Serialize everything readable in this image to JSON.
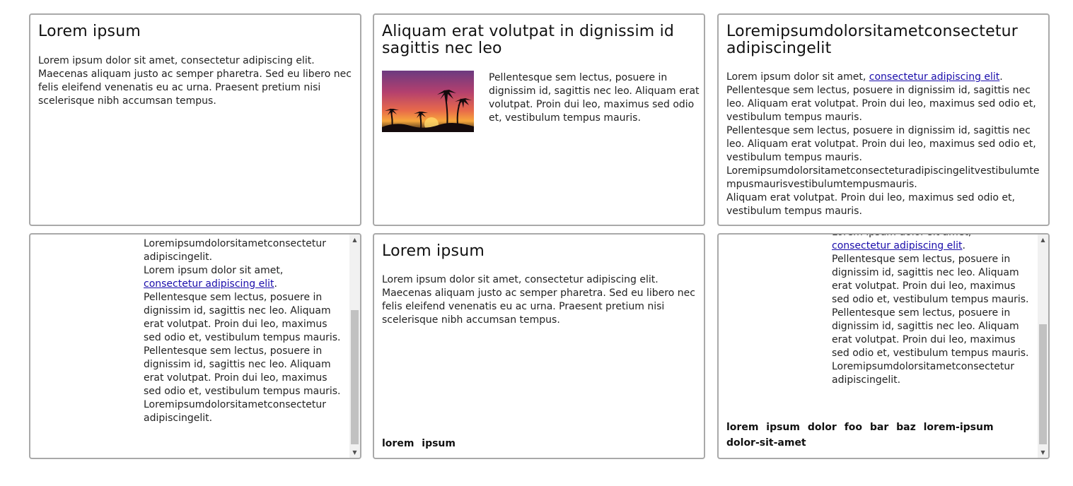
{
  "cards": [
    {
      "title": "Lorem ipsum",
      "body": "Lorem ipsum dolor sit amet, consectetur adipiscing elit. Maecenas aliquam justo ac semper pharetra. Sed eu libero nec felis eleifend venenatis eu ac urna. Praesent pretium nisi scelerisque nibh accumsan tempus."
    },
    {
      "title": "Aliquam erat volutpat in dignissim id sagittis nec leo",
      "image_name": "sunset-palms-image",
      "body": "Pellentesque sem lectus, posuere in dignissim id, sagittis nec leo. Aliquam erat volutpat. Proin dui leo, maximus sed odio et, vestibulum tempus mauris."
    },
    {
      "title": "Loremipsumdolorsitametconsectetur adipiscingelit",
      "body_prefix": "Lorem ipsum dolor sit amet, ",
      "link_text": "consectetur adipiscing elit",
      "body_suffix": ".",
      "paragraphs": [
        "Pellentesque sem lectus, posuere in dignissim id, sagittis nec leo. Aliquam erat volutpat. Proin dui leo, maximus sed odio et, vestibulum tempus mauris.",
        "Pellentesque sem lectus, posuere in dignissim id, sagittis nec leo. Aliquam erat volutpat. Proin dui leo, maximus sed odio et, vestibulum tempus mauris.",
        "Loremipsumdolorsitametconsecteturadipiscingelitvestibulumtempusmaurisvestibulumtempusmauris.",
        "Aliquam erat volutpat. Proin dui leo, maximus sed odio et, vestibulum tempus mauris."
      ]
    },
    {
      "line1": "Loremipsumdolorsitametconsectetur adipiscingelit.",
      "body_prefix": "Lorem ipsum dolor sit amet, ",
      "link_text": "consectetur adipiscing elit",
      "body_suffix": ".",
      "paragraphs": [
        "Pellentesque sem lectus, posuere in dignissim id, sagittis nec leo. Aliquam erat volutpat. Proin dui leo, maximus sed odio et, vestibulum tempus mauris.",
        "Pellentesque sem lectus, posuere in dignissim id, sagittis nec leo. Aliquam erat volutpat. Proin dui leo, maximus sed odio et, vestibulum tempus mauris.",
        "Loremipsumdolorsitametconsectetur adipiscingelit."
      ]
    },
    {
      "title": "Lorem ipsum",
      "body": "Lorem ipsum dolor sit amet, consectetur adipiscing elit. Maecenas aliquam justo ac semper pharetra. Sed eu libero nec felis eleifend venenatis eu ac urna. Praesent pretium nisi scelerisque nibh accumsan tempus.",
      "footer": "lorem ipsum"
    },
    {
      "line0": "Lorem ipsum dolor sit amet,",
      "link_text": "consectetur adipiscing elit",
      "body_suffix": ".",
      "paragraphs": [
        "Pellentesque sem lectus, posuere in dignissim id, sagittis nec leo. Aliquam erat volutpat. Proin dui leo, maximus sed odio et, vestibulum tempus mauris.",
        "Pellentesque sem lectus, posuere in dignissim id, sagittis nec leo. Aliquam erat volutpat. Proin dui leo, maximus sed odio et, vestibulum tempus mauris.",
        "Loremipsumdolorsitametconsectetur adipiscingelit."
      ],
      "footer": "lorem ipsum dolor foo bar baz lorem-ipsum dolor-sit-amet"
    }
  ],
  "scrollbar": {
    "up_icon": "scroll-up-arrow-icon",
    "down_icon": "scroll-down-arrow-icon"
  },
  "colors": {
    "border": "#a9a9a9",
    "link": "#1a0dab",
    "scroll_thumb": "#c1c1c1",
    "scroll_track": "#f1f1f1"
  }
}
